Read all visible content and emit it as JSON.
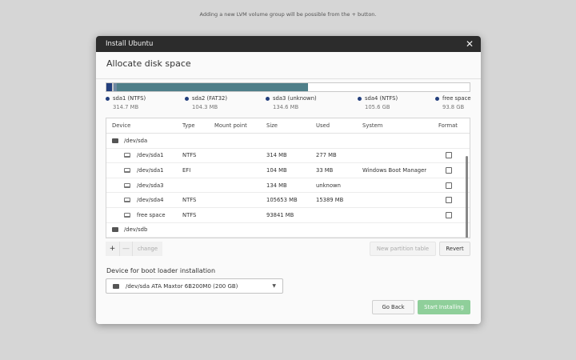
{
  "hint": "Adding a new LVM volume group will be possible from the + button.",
  "window": {
    "title": "Install Ubuntu",
    "close_icon": "close-icon"
  },
  "page_title": "Allocate disk space",
  "usage_bar": {
    "total_mb": 200000,
    "segments": [
      {
        "name": "sda1 (NTFS)",
        "color": "#233f7d",
        "fraction": 0.0157
      },
      {
        "name": "sda2 (FAT32)",
        "color": "#c8c8c8",
        "fraction": 0.0052
      },
      {
        "name": "sda3 (unknown)",
        "color": "#6e8aa3",
        "fraction": 0.0067
      },
      {
        "name": "sda4 (NTFS)",
        "color": "#4f7f89",
        "fraction": 0.5282
      },
      {
        "name": "free space",
        "color": "#ffffff",
        "fraction": 0.4442
      }
    ]
  },
  "legend": [
    {
      "label": "sda1 (NTFS)",
      "size": "314.7 MB",
      "color": "#233f7d"
    },
    {
      "label": "sda2 (FAT32)",
      "size": "104.3 MB",
      "color": "#233f7d"
    },
    {
      "label": "sda3 (unknown)",
      "size": "134.6 MB",
      "color": "#233f7d"
    },
    {
      "label": "sda4 (NTFS)",
      "size": "105.6 GB",
      "color": "#233f7d"
    },
    {
      "label": "free space",
      "size": "93.8 GB",
      "color": "#233f7d"
    }
  ],
  "table": {
    "headers": [
      "Device",
      "Type",
      "Mount point",
      "Size",
      "Used",
      "System",
      "Format"
    ],
    "rows": [
      {
        "kind": "disk",
        "device": "/dev/sda",
        "type": "",
        "mount": "",
        "size": "",
        "used": "",
        "system": "",
        "format": false
      },
      {
        "kind": "part",
        "device": "/dev/sda1",
        "type": "NTFS",
        "mount": "",
        "size": "314 MB",
        "used": "277 MB",
        "system": "",
        "format": true
      },
      {
        "kind": "part",
        "device": "/dev/sda1",
        "type": "EFI",
        "mount": "",
        "size": "104 MB",
        "used": "33 MB",
        "system": "Windows Boot Manager",
        "format": true
      },
      {
        "kind": "part",
        "device": "/dev/sda3",
        "type": "",
        "mount": "",
        "size": "134 MB",
        "used": "unknown",
        "system": "",
        "format": true
      },
      {
        "kind": "part",
        "device": "/dev/sda4",
        "type": "NTFS",
        "mount": "",
        "size": "105653 MB",
        "used": "15389 MB",
        "system": "",
        "format": true
      },
      {
        "kind": "part",
        "device": "free space",
        "type": "NTFS",
        "mount": "",
        "size": "93841 MB",
        "used": "",
        "system": "",
        "format": true
      },
      {
        "kind": "disk",
        "device": "/dev/sdb",
        "type": "",
        "mount": "",
        "size": "",
        "used": "",
        "system": "",
        "format": false
      }
    ]
  },
  "toolbar": {
    "add_label": "+",
    "remove_label": "—",
    "change_label": "change",
    "new_table_label": "New partition table",
    "revert_label": "Revert"
  },
  "bootloader": {
    "label": "Device for boot loader installation",
    "selected": "/dev/sda ATA Maxtor 6B200M0 (200 GB)"
  },
  "footer": {
    "back_label": "Go Back",
    "install_label": "Start Installing",
    "install_color": "#8fcf9a"
  }
}
